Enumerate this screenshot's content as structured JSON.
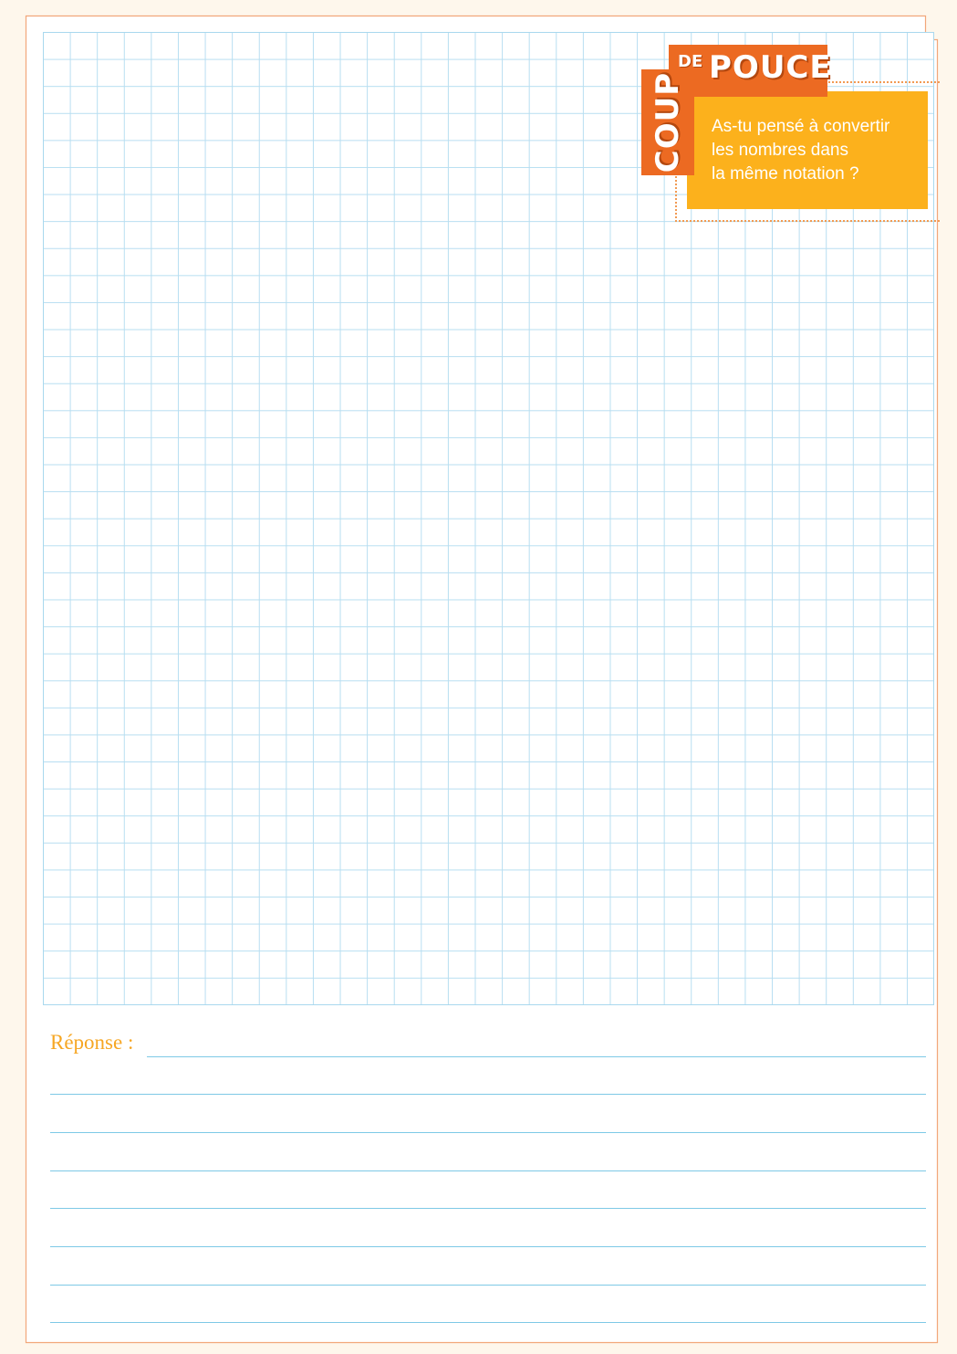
{
  "tip": {
    "word_coup": "COUP",
    "word_de": "DE",
    "word_pouce": "POUCE",
    "message": "As-tu pensé à convertir\nles nombres dans\nla même notation ?"
  },
  "answer": {
    "label": "Réponse :",
    "line_count": 8
  },
  "colors": {
    "badge_orange": "#ec6a22",
    "note_yellow": "#fcb11c",
    "grid_blue": "#b7def1",
    "label_orange": "#f6a623"
  }
}
